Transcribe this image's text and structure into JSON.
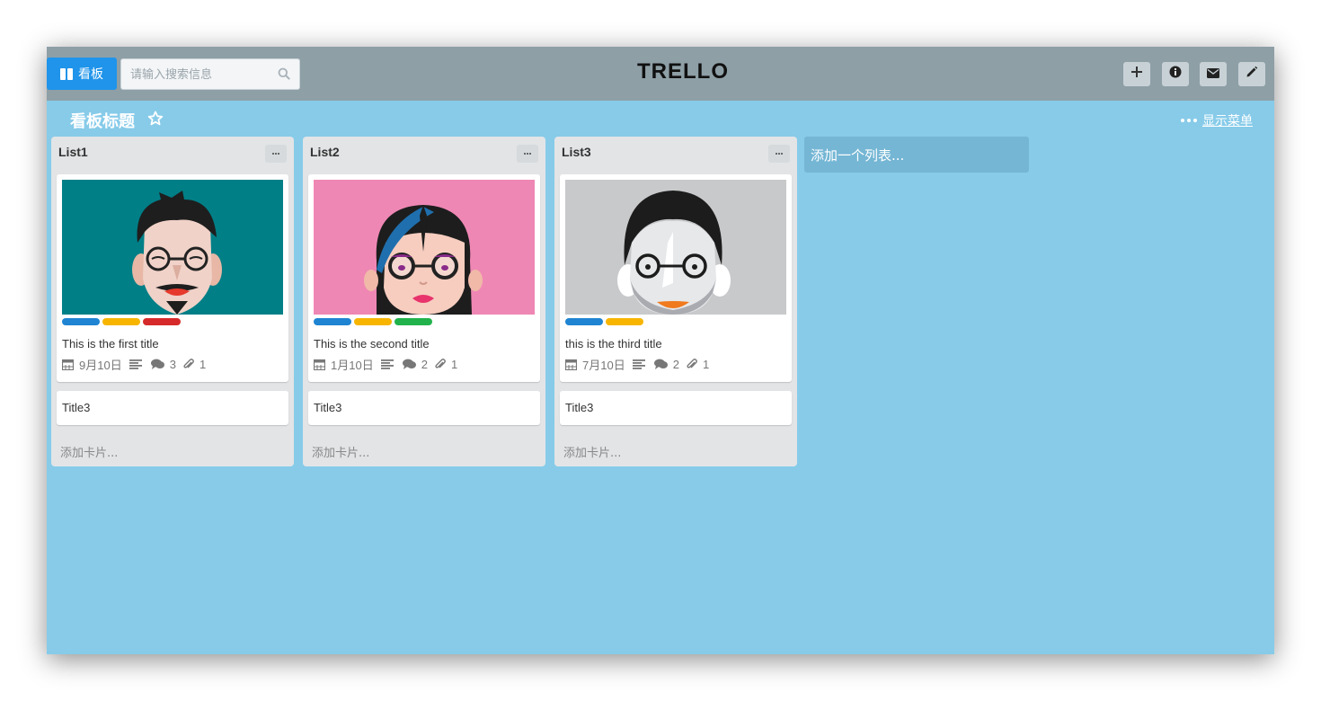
{
  "header": {
    "board_button_label": "看板",
    "search_placeholder": "请输入搜索信息",
    "logo": "TRELLO",
    "actions": [
      "add-icon",
      "info-icon",
      "envelope-icon",
      "pencil-icon"
    ]
  },
  "board": {
    "title": "看板标题",
    "menu_label": "显示菜单",
    "add_list_label": "添加一个列表..."
  },
  "colors": {
    "label_blue": "#1f84d2",
    "label_yellow": "#f7b500",
    "label_red": "#d62a2a",
    "label_green": "#22b24c",
    "background": "#87cbe9",
    "topbar": "#8e9fa6"
  },
  "lists": [
    {
      "title": "List1",
      "card": {
        "title": "This is the first title",
        "due": "9月10日",
        "comments": "3",
        "attachments": "1",
        "labels": [
          "blue",
          "yellow",
          "red"
        ]
      },
      "card2_title": "Title3",
      "add_card_label": "添加卡片..."
    },
    {
      "title": "List2",
      "card": {
        "title": "This is the second title",
        "due": "1月10日",
        "comments": "2",
        "attachments": "1",
        "labels": [
          "blue",
          "yellow",
          "green"
        ]
      },
      "card2_title": "Title3",
      "add_card_label": "添加卡片..."
    },
    {
      "title": "List3",
      "card": {
        "title": "this is the third title",
        "due": "7月10日",
        "comments": "2",
        "attachments": "1",
        "labels": [
          "blue",
          "yellow"
        ]
      },
      "card2_title": "Title3",
      "add_card_label": "添加卡片..."
    }
  ]
}
